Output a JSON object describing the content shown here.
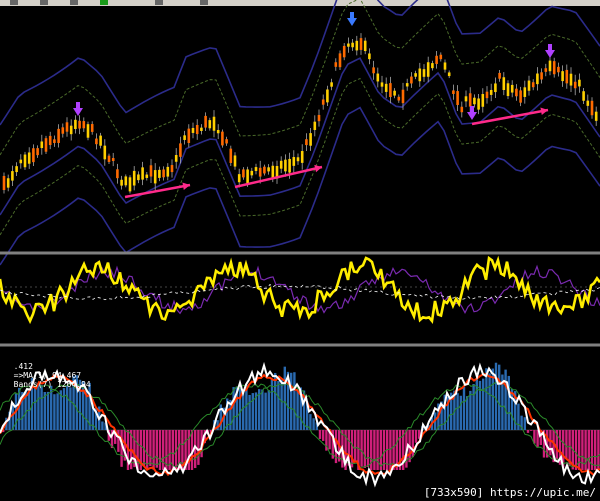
{
  "window": {
    "title": "",
    "toolbar_icons": [
      "arrow-icon",
      "arrow-icon",
      "arrow-icon",
      "plus-icon",
      "arrow-icon",
      "arrow-icon"
    ]
  },
  "colors": {
    "background": "#000000",
    "candle_body": "#ffd000",
    "candle_bear": "#ff6a00",
    "bollinger_outer": "#2b2b8a",
    "bollinger_inner": "#4a6a2a",
    "divergence_arrow": "#ff2a8a",
    "signal_arrow_blue": "#3a7aff",
    "signal_arrow_purple": "#b040ff",
    "oscillator_line": "#ffee00",
    "oscillator_signal": "#7a2ab0",
    "hist_positive": "#2a6ab0",
    "hist_negative": "#d0207a",
    "osc2_white": "#ffffff",
    "osc2_red": "#ff3300",
    "osc2_green": "#2a8a2a",
    "panel_separator": "#808080"
  },
  "subwindow3": {
    "indicator_prefix": ".412",
    "ma_label": "=>MA(1) 94.467",
    "bands_label": "Bands(7) 1264.94"
  },
  "watermark": "[733x590] https://upic.me/"
}
